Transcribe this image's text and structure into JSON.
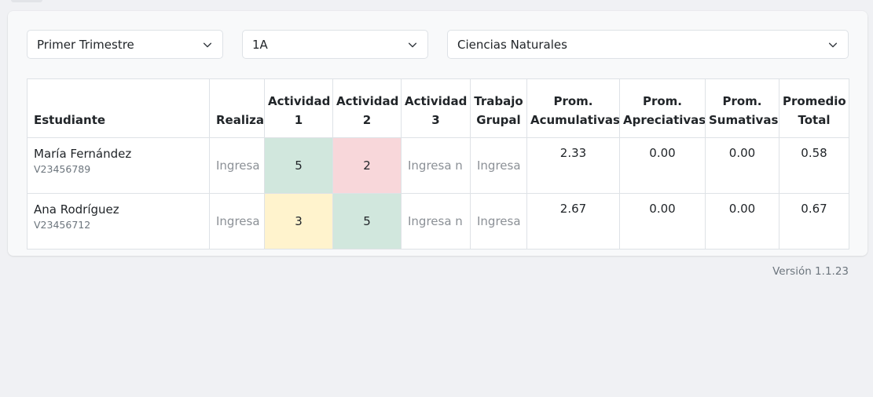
{
  "filters": {
    "period": "Primer Trimestre",
    "grade": "1A",
    "subject": "Ciencias Naturales"
  },
  "table": {
    "headers": {
      "student": "Estudiante",
      "realiza": "Realiza",
      "act1_line1": "Actividad",
      "act1_line2": "1",
      "act2_line1": "Actividad",
      "act2_line2": "2",
      "act3_line1": "Actividad",
      "act3_line2": "3",
      "group_line1": "Trabajo",
      "group_line2": "Grupal",
      "acum_line1": "Prom.",
      "acum_line2": "Acumulativas",
      "apre_line1": "Prom.",
      "apre_line2": "Apreciativas",
      "suma_line1": "Prom.",
      "suma_line2": "Sumativas",
      "total_line1": "Promedio",
      "total_line2": "Total"
    },
    "rows": [
      {
        "name": "María Fernández",
        "id": "V23456789",
        "realiza_placeholder": "Ingresa",
        "act1": "5",
        "act2": "2",
        "act3_placeholder": "Ingresa n",
        "group_placeholder": "Ingresa",
        "prom_acumulativas": "2.33",
        "prom_apreciativas": "0.00",
        "prom_sumativas": "0.00",
        "promedio_total": "0.58"
      },
      {
        "name": "Ana Rodríguez",
        "id": "V23456712",
        "realiza_placeholder": "Ingresa",
        "act1": "3",
        "act2": "5",
        "act3_placeholder": "Ingresa n",
        "group_placeholder": "Ingresa",
        "prom_acumulativas": "2.67",
        "prom_apreciativas": "0.00",
        "prom_sumativas": "0.00",
        "promedio_total": "0.67"
      }
    ]
  },
  "colors": {
    "good": "#d1e7dd",
    "bad": "#f8d7da",
    "medium": "#fff3cd"
  },
  "icons": {
    "dropdown": "chevron-down-icon"
  },
  "footer": {
    "version": "Versión 1.1.23"
  }
}
